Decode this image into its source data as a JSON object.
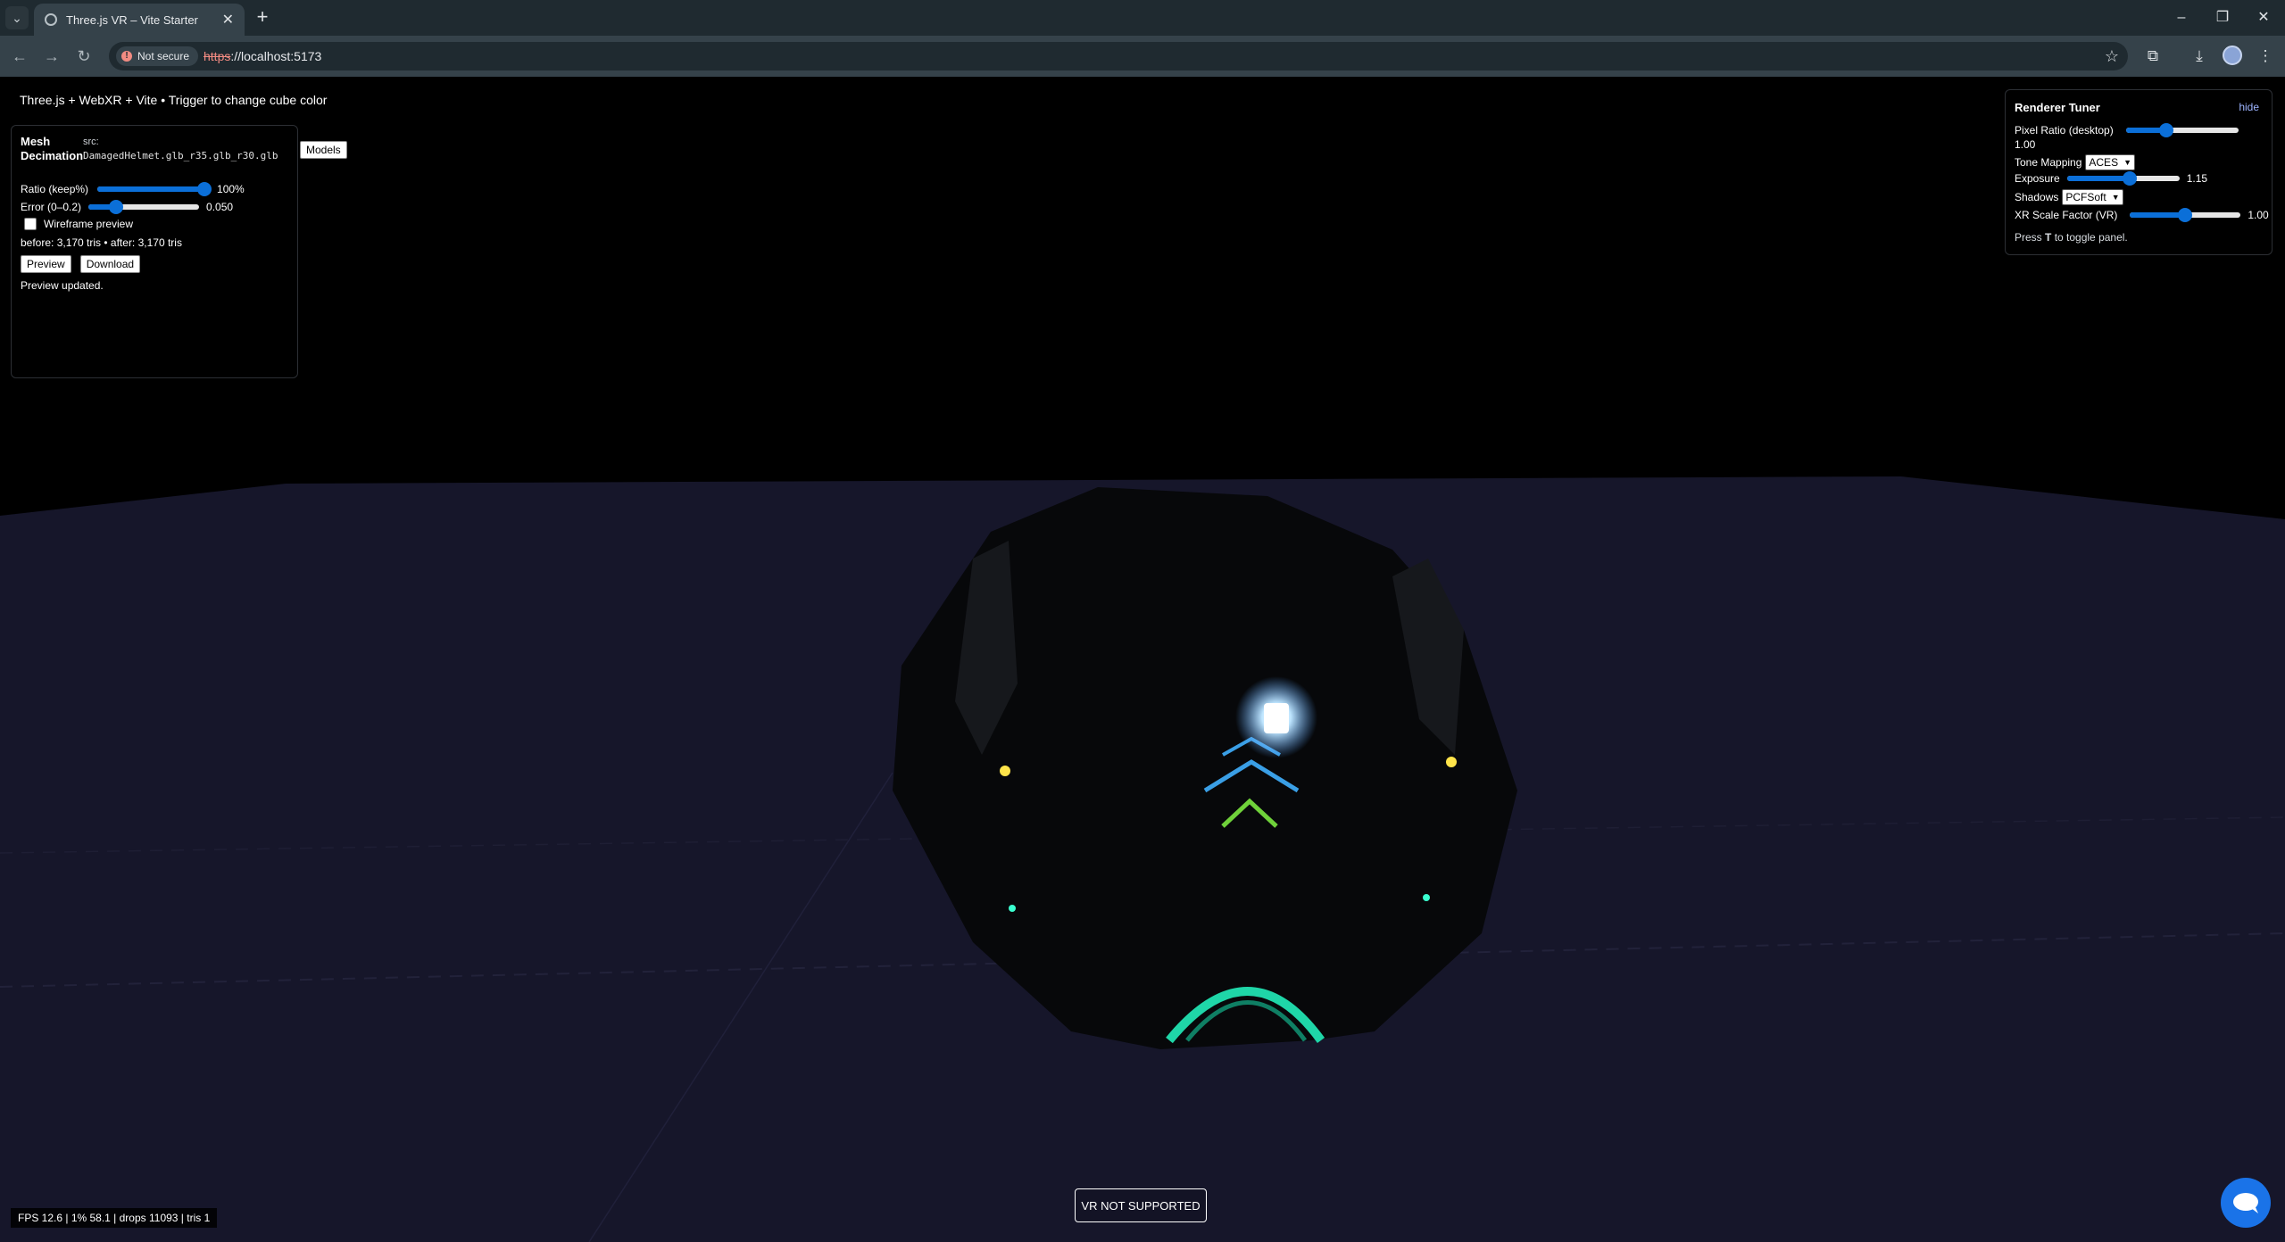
{
  "browser": {
    "tab_title": "Three.js VR – Vite Starter",
    "security_chip": "Not secure",
    "url_protocol": "https",
    "url_rest": "://localhost:5173"
  },
  "app": {
    "heading": "Three.js + WebXR + Vite • Trigger to change cube color",
    "mesh_panel": {
      "title_line1": "Mesh",
      "title_line2": "Decimation",
      "src_label": "src:",
      "src_value": "DamagedHelmet.glb_r35.glb_r30.glb",
      "models_button": "Models",
      "ratio_label": "Ratio (keep%)",
      "ratio_value": "100%",
      "ratio_level": 1.0,
      "error_label": "Error (0–0.2)",
      "error_value": "0.050",
      "error_level": 0.25,
      "wireframe_label": "Wireframe preview",
      "wireframe_checked": false,
      "tri_counts": "before: 3,170 tris • after: 3,170 tris",
      "preview_button": "Preview",
      "download_button": "Download",
      "status": "Preview updated."
    },
    "tuner_panel": {
      "title": "Renderer Tuner",
      "hide_link": "hide",
      "pixel_ratio_label": "Pixel Ratio (desktop)",
      "pixel_ratio_value": "1.00",
      "pixel_ratio_level": 0.36,
      "tone_mapping_label": "Tone Mapping",
      "tone_mapping_value": "ACES",
      "exposure_label": "Exposure",
      "exposure_value": "1.15",
      "exposure_level": 0.56,
      "shadows_label": "Shadows",
      "shadows_value": "PCFSoft",
      "xr_scale_label": "XR Scale Factor (VR)",
      "xr_scale_value": "1.00",
      "xr_scale_level": 0.5,
      "hint_prefix": "Press ",
      "hint_key": "T",
      "hint_suffix": " to toggle panel."
    },
    "vr_button": "VR NOT SUPPORTED",
    "stats": "FPS 12.6 | 1% 58.1 | drops 11093 | tris 1"
  },
  "colors": {
    "accent": "#0b6fd8",
    "chrome_bg": "#35424a",
    "floor": "#16162a"
  }
}
